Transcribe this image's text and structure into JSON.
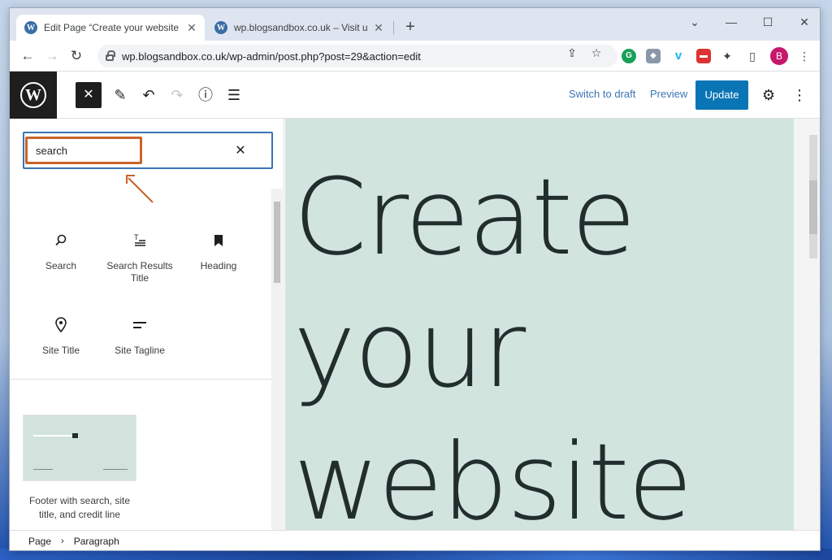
{
  "browser": {
    "tabs": [
      {
        "title": "Edit Page “Create your website w",
        "close": "✕"
      },
      {
        "title": "wp.blogsandbox.co.uk – Visit us",
        "close": "✕"
      }
    ],
    "new_tab": "+",
    "controls": {
      "minimize": "⌄",
      "restore": "—",
      "maximize": "☐",
      "close": "✕"
    },
    "url": "wp.blogsandbox.co.uk/wp-admin/post.php?post=29&action=edit",
    "profile_initial": "B"
  },
  "editor": {
    "header": {
      "switch_to_draft": "Switch to draft",
      "preview": "Preview",
      "update": "Update"
    },
    "inserter": {
      "search_value": "search",
      "blocks": [
        {
          "label": "Search",
          "icon": "search-icon"
        },
        {
          "label": "Search Results Title",
          "icon": "search-results-title-icon"
        },
        {
          "label": "Heading",
          "icon": "bookmark-icon"
        },
        {
          "label": "Site Title",
          "icon": "map-pin-icon"
        },
        {
          "label": "Site Tagline",
          "icon": "tagline-icon"
        }
      ],
      "pattern": {
        "label": "Footer with search, site title, and credit line"
      }
    },
    "canvas": {
      "heading_lines": [
        "Create",
        "your",
        "website"
      ]
    },
    "breadcrumb": {
      "items": [
        "Page",
        "Paragraph"
      ],
      "separator": "›"
    }
  }
}
